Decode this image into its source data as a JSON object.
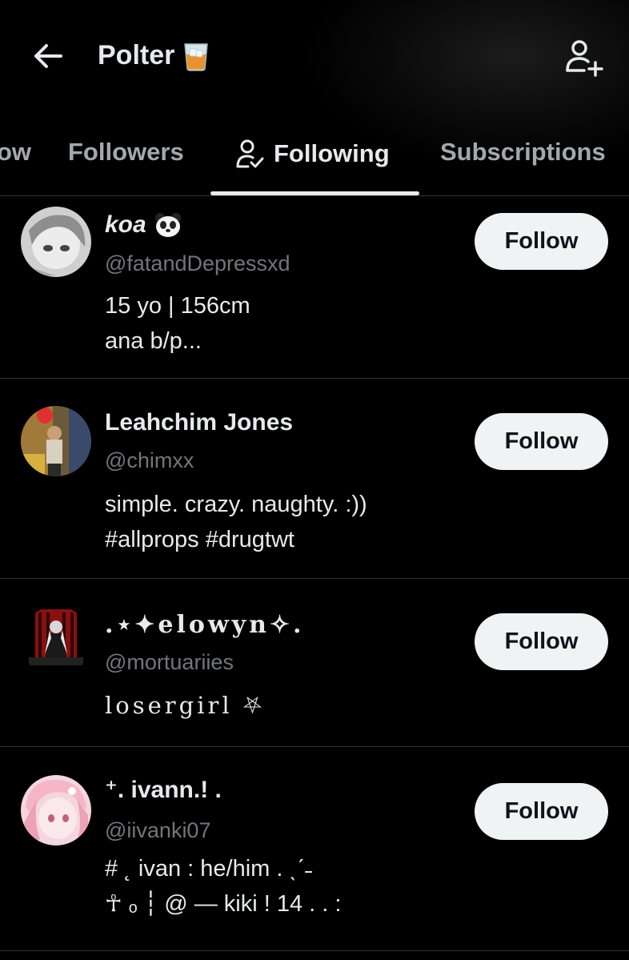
{
  "header": {
    "title": "Polter",
    "title_emoji": "tumbler-glass-emoji"
  },
  "tabs": [
    {
      "label": "ow"
    },
    {
      "label": "Followers"
    },
    {
      "label": "Following",
      "active": true
    },
    {
      "label": "Subscriptions"
    }
  ],
  "users": [
    {
      "name": "koa",
      "name_emoji": "panda-emoji",
      "handle": "@fatandDepressxd",
      "bio": "15 yo | 156cm\nana b/p...",
      "button": "Follow"
    },
    {
      "name": "Leahchim Jones",
      "handle": "@chimxx",
      "bio": "simple. crazy. naughty. :))\n#allprops #drugtwt",
      "button": "Follow"
    },
    {
      "name": ".⋆✦elowyn✧.",
      "handle": "@mortuariies",
      "bio": "losergirl ⛧",
      "button": "Follow"
    },
    {
      "name": "⁺. ivann.! .",
      "handle": "@iivanki07",
      "bio": "# ˛   ivan   :  he/him  .  ˎˊ˗\n☥ ₒ ┆  @  —  kiki  ! 14 . .  :",
      "button": "Follow"
    }
  ],
  "colors": {
    "background": "#000000",
    "text_primary": "#e7e9ea",
    "text_secondary": "#71767b",
    "tab_inactive": "#a3a8ad",
    "button_bg": "#eff3f4",
    "button_text": "#0f1419",
    "divider": "#2f3336"
  }
}
